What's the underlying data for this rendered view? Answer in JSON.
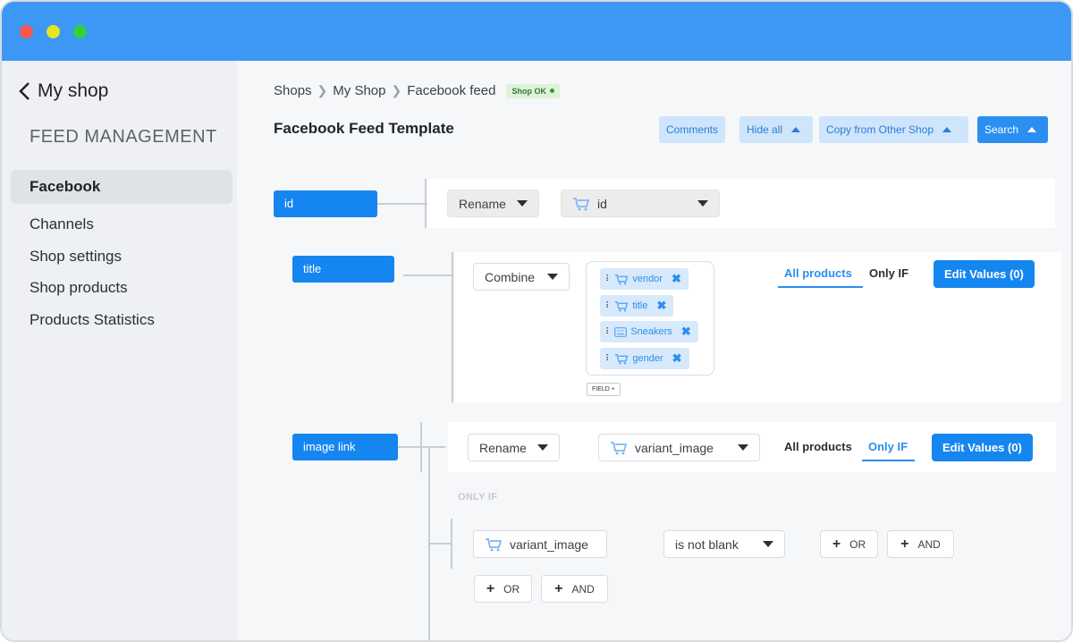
{
  "sidebar": {
    "back_label": "My shop",
    "section_title": "FEED MANAGEMENT",
    "items": [
      {
        "label": "Facebook",
        "active": true
      },
      {
        "label": "Channels"
      },
      {
        "label": "Shop settings"
      },
      {
        "label": "Shop products"
      },
      {
        "label": "Products Statistics"
      }
    ]
  },
  "breadcrumb": {
    "items": [
      "Shops",
      "My Shop",
      "Facebook feed"
    ],
    "status_badge": "Shop OK"
  },
  "header": {
    "title": "Facebook Feed Template",
    "buttons": {
      "comments": "Comments",
      "hide_all": "Hide all",
      "copy_from": "Copy from Other Shop",
      "search": "Search"
    }
  },
  "rows": {
    "id": {
      "field": "id",
      "action": "Rename",
      "source": "id"
    },
    "title": {
      "field": "title",
      "action": "Combine",
      "tags": [
        "vendor",
        "title",
        "Sneakers",
        "gender"
      ],
      "field_add": "FIELD +",
      "tab_all": "All products",
      "tab_only_if": "Only IF",
      "edit_values": "Edit Values (0)"
    },
    "image_link": {
      "field": "image link",
      "action": "Rename",
      "source": "variant_image",
      "tab_all": "All products",
      "tab_only_if": "Only IF",
      "edit_values": "Edit Values (0)",
      "only_if_label": "ONLY IF",
      "condition_field": "variant_image",
      "condition_op": "is not blank",
      "or_label": "OR",
      "and_label": "AND"
    }
  },
  "colors": {
    "titlebar": "#3d97f5",
    "accent": "#1586f0",
    "tag_bg": "#d7e9fb"
  }
}
